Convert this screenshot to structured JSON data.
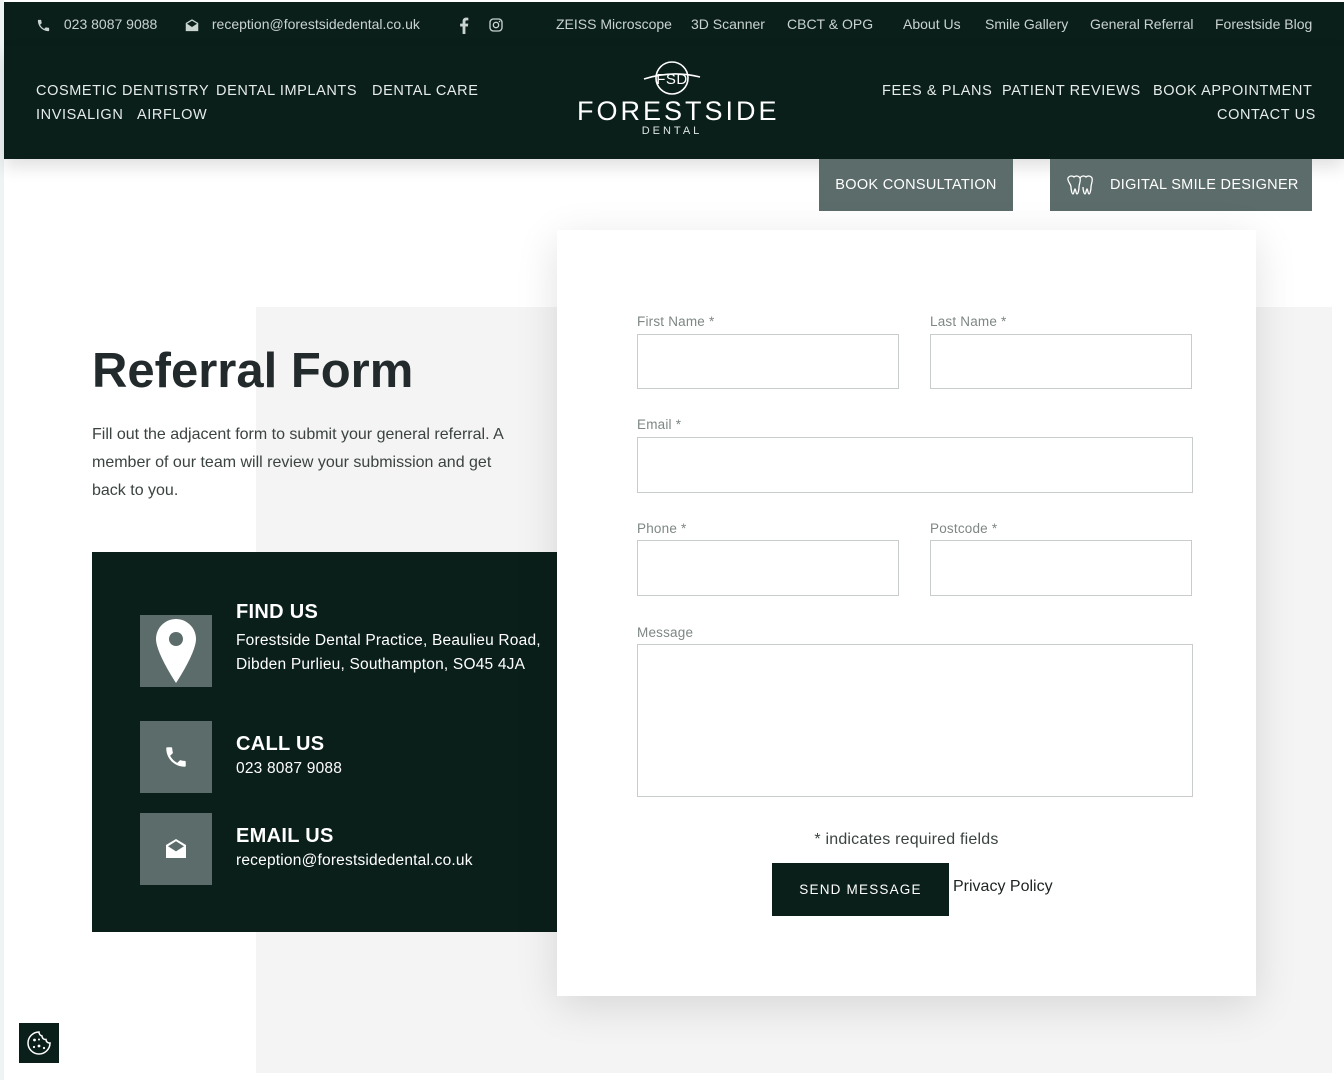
{
  "topbar": {
    "phone": "023 8087 9088",
    "email": "reception@forestsidedental.co.uk",
    "social_icons": [
      "facebook-icon",
      "instagram-icon"
    ],
    "links": [
      "ZEISS Microscope",
      "3D Scanner",
      "CBCT & OPG",
      "About Us",
      "Smile Gallery",
      "General Referral",
      "Forestside Blog"
    ]
  },
  "nav": {
    "left": [
      "COSMETIC DENTISTRY",
      "DENTAL IMPLANTS",
      "DENTAL CARE",
      "INVISALIGN",
      "AIRFLOW"
    ],
    "right": [
      "FEES & PLANS",
      "PATIENT REVIEWS",
      "BOOK APPOINTMENT",
      "CONTACT US"
    ]
  },
  "logo": {
    "monogram": "FSD",
    "name": "FORESTSIDE",
    "sub": "DENTAL"
  },
  "cta": {
    "consultation": "BOOK CONSULTATION",
    "smile_designer": "DIGITAL SMILE DESIGNER",
    "smile_designer_icon": "teeth-icon"
  },
  "intro": {
    "title": "Referral Form",
    "text": "Fill out the adjacent form to submit your general referral. A member of our team will review your submission and get back to you."
  },
  "contact": {
    "find": {
      "icon": "map-pin-icon",
      "heading": "FIND US",
      "text": "Forestside Dental Practice, Beaulieu Road, Dibden Purlieu, Southampton, SO45 4JA"
    },
    "call": {
      "icon": "phone-icon",
      "heading": "CALL US",
      "text": "023 8087 9088"
    },
    "email": {
      "icon": "envelope-icon",
      "heading": "EMAIL US",
      "text": "reception@forestsidedental.co.uk"
    }
  },
  "form": {
    "first_name": {
      "label": "First Name *",
      "value": "",
      "placeholder": ""
    },
    "last_name": {
      "label": "Last Name *",
      "value": "",
      "placeholder": ""
    },
    "email": {
      "label": "Email *",
      "value": "",
      "placeholder": ""
    },
    "phone": {
      "label": "Phone *",
      "value": "",
      "placeholder": ""
    },
    "postcode": {
      "label": "Postcode *",
      "value": "",
      "placeholder": ""
    },
    "message": {
      "label": "Message",
      "value": "",
      "placeholder": ""
    },
    "required_note": "* indicates required fields",
    "submit": "SEND MESSAGE",
    "privacy": "Privacy Policy"
  },
  "cookie_icon": "cookie-icon",
  "colors": {
    "brand_dark": "#0b1f1a",
    "accent_grey": "#5c6c6a",
    "panel_grey": "#f4f4f4"
  }
}
